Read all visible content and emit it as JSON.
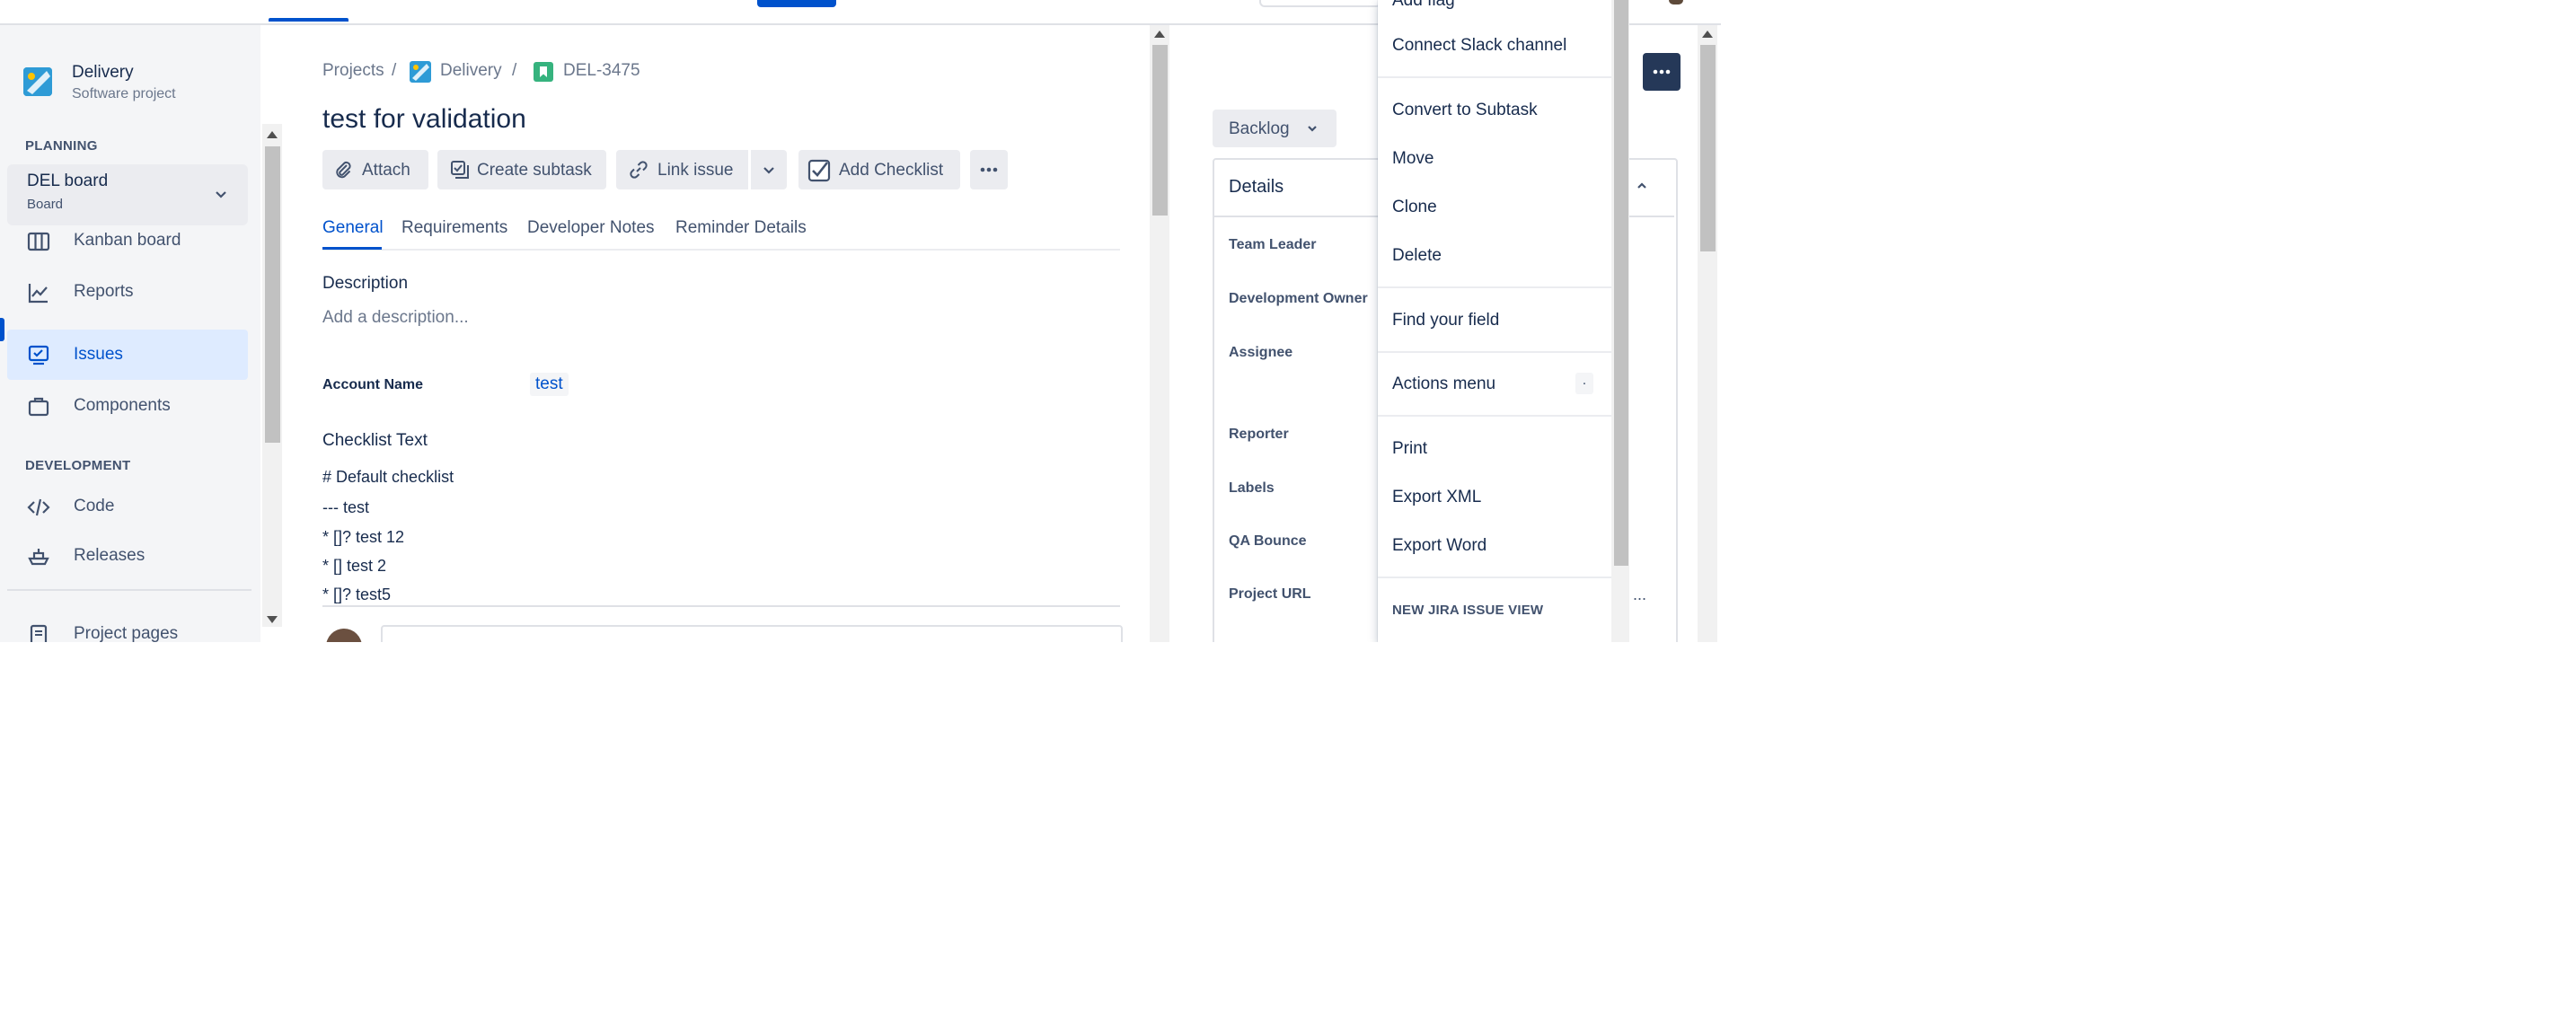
{
  "sidebar": {
    "project_name": "Delivery",
    "project_type": "Software project",
    "planning_heading": "PLANNING",
    "board_name": "DEL board",
    "board_type": "Board",
    "items": [
      {
        "label": "Kanban board"
      },
      {
        "label": "Reports"
      },
      {
        "label": "Issues"
      },
      {
        "label": "Components"
      }
    ],
    "development_heading": "DEVELOPMENT",
    "dev_items": [
      {
        "label": "Code"
      },
      {
        "label": "Releases"
      }
    ],
    "project_pages": "Project pages"
  },
  "breadcrumb": {
    "projects": "Projects",
    "sep": "/",
    "project": "Delivery",
    "issue_key": "DEL-3475"
  },
  "issue": {
    "title": "test for validation",
    "actions": {
      "attach": "Attach",
      "create_subtask": "Create subtask",
      "link_issue": "Link issue",
      "add_checklist": "Add Checklist"
    },
    "tabs": [
      "General",
      "Requirements",
      "Developer Notes",
      "Reminder Details"
    ],
    "description_label": "Description",
    "description_placeholder": "Add a description...",
    "account_name_label": "Account Name",
    "account_name_value": "test",
    "checklist_label": "Checklist Text",
    "checklist_lines": [
      "# Default checklist",
      "--- test",
      "* []? test 12",
      "* [] test 2",
      "* []? test5"
    ]
  },
  "right_panel": {
    "status": "Backlog",
    "details_heading": "Details",
    "fields": [
      "Team Leader",
      "Development Owner",
      "Assignee",
      "Reporter",
      "Labels",
      "QA Bounce",
      "Project URL"
    ],
    "truncated_value": "..."
  },
  "menu": {
    "partial_top": "Add flag",
    "items": [
      "Connect Slack channel",
      "Convert to Subtask",
      "Move",
      "Clone",
      "Delete",
      "Find your field",
      "Actions menu",
      "Print",
      "Export XML",
      "Export Word"
    ],
    "shortcut": ".",
    "section_heading": "NEW JIRA ISSUE VIEW"
  },
  "colors": {
    "accent": "#0052cc",
    "sidebar_bg": "#f4f5f7",
    "text": "#172b4d",
    "subtle": "#6b778c",
    "selected_bg": "#deebff",
    "dark_button": "#253858",
    "story_green": "#36b37e"
  }
}
